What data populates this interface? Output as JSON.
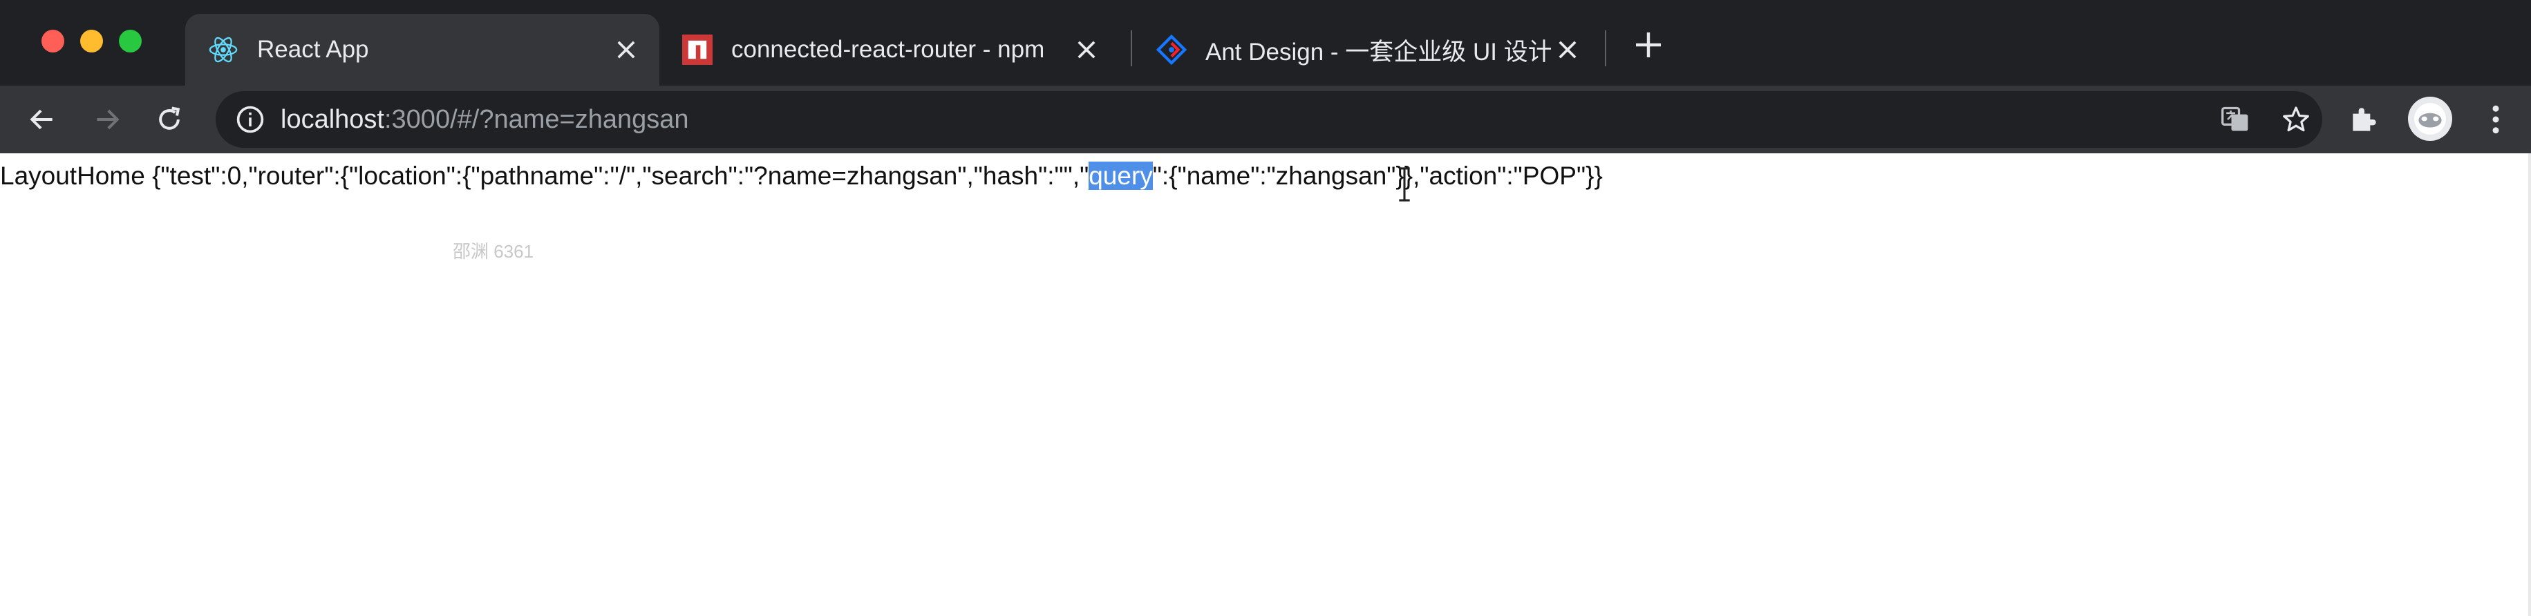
{
  "window": {
    "traffic_lights": [
      "close",
      "minimize",
      "zoom"
    ]
  },
  "tabs": [
    {
      "title": "React App",
      "icon": "react-icon",
      "active": true
    },
    {
      "title": "connected-react-router - npm",
      "icon": "npm-icon",
      "active": false
    },
    {
      "title": "Ant Design - 一套企业级 UI 设计",
      "icon": "ant-design-icon",
      "active": false
    }
  ],
  "new_tab_label": "+",
  "toolbar": {
    "url_host": "localhost",
    "url_rest": ":3000/#/?name=zhangsan"
  },
  "page": {
    "output_before": "LayoutHome {\"test\":0,\"router\":{\"location\":{\"pathname\":\"/\",\"search\":\"?name=zhangsan\",\"hash\":\"\",\"",
    "output_selected": "query",
    "output_after": "\":{\"name\":\"zhangsan\"}},\"action\":\"POP\"}}",
    "watermark": "邵渊 6361"
  },
  "colors": {
    "tab_bg_active": "#35363a",
    "titlebar": "#202124",
    "selection": "#4f8fe8"
  }
}
